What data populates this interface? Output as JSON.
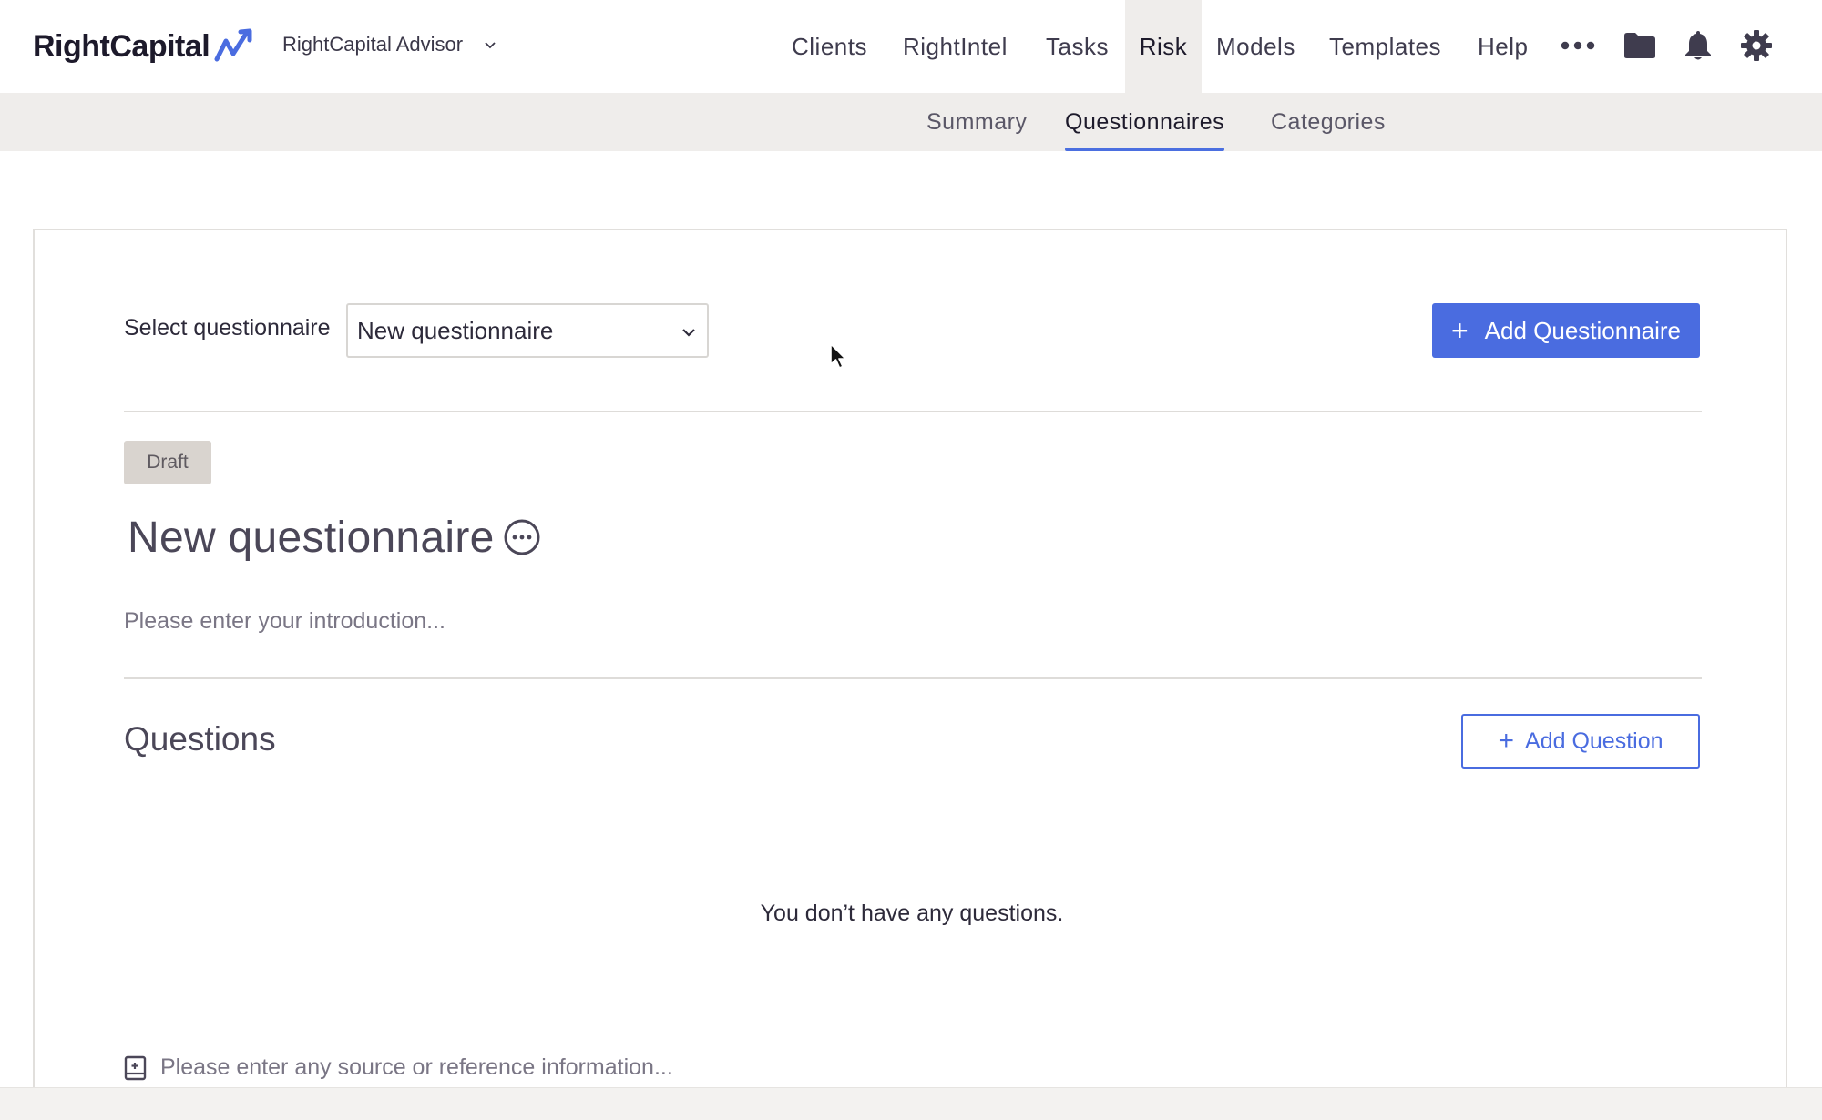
{
  "header": {
    "logo_text": "RightCapital",
    "advisor_name": "RightCapital Advisor",
    "nav": [
      {
        "label": "Clients"
      },
      {
        "label": "RightIntel"
      },
      {
        "label": "Tasks"
      },
      {
        "label": "Risk"
      },
      {
        "label": "Models"
      },
      {
        "label": "Templates"
      },
      {
        "label": "Help"
      }
    ],
    "active_nav": "Risk",
    "icons": [
      "more-horizontal-icon",
      "folder-icon",
      "bell-icon",
      "gear-icon"
    ]
  },
  "subnav": {
    "items": [
      {
        "label": "Summary"
      },
      {
        "label": "Questionnaires"
      },
      {
        "label": "Categories"
      }
    ],
    "active": "Questionnaires"
  },
  "main": {
    "select_label": "Select questionnaire",
    "selected_questionnaire": "New questionnaire",
    "add_questionnaire_label": "Add Questionnaire",
    "status_badge": "Draft",
    "questionnaire_title": "New questionnaire",
    "intro_placeholder": "Please enter your introduction...",
    "questions_heading": "Questions",
    "add_question_label": "Add Question",
    "empty_message": "You don’t have any questions.",
    "source_placeholder": "Please enter any source or reference information..."
  },
  "colors": {
    "accent": "#4a6ce0",
    "subnav_bg": "#efedeb",
    "badge_bg": "#d9d4cf"
  }
}
